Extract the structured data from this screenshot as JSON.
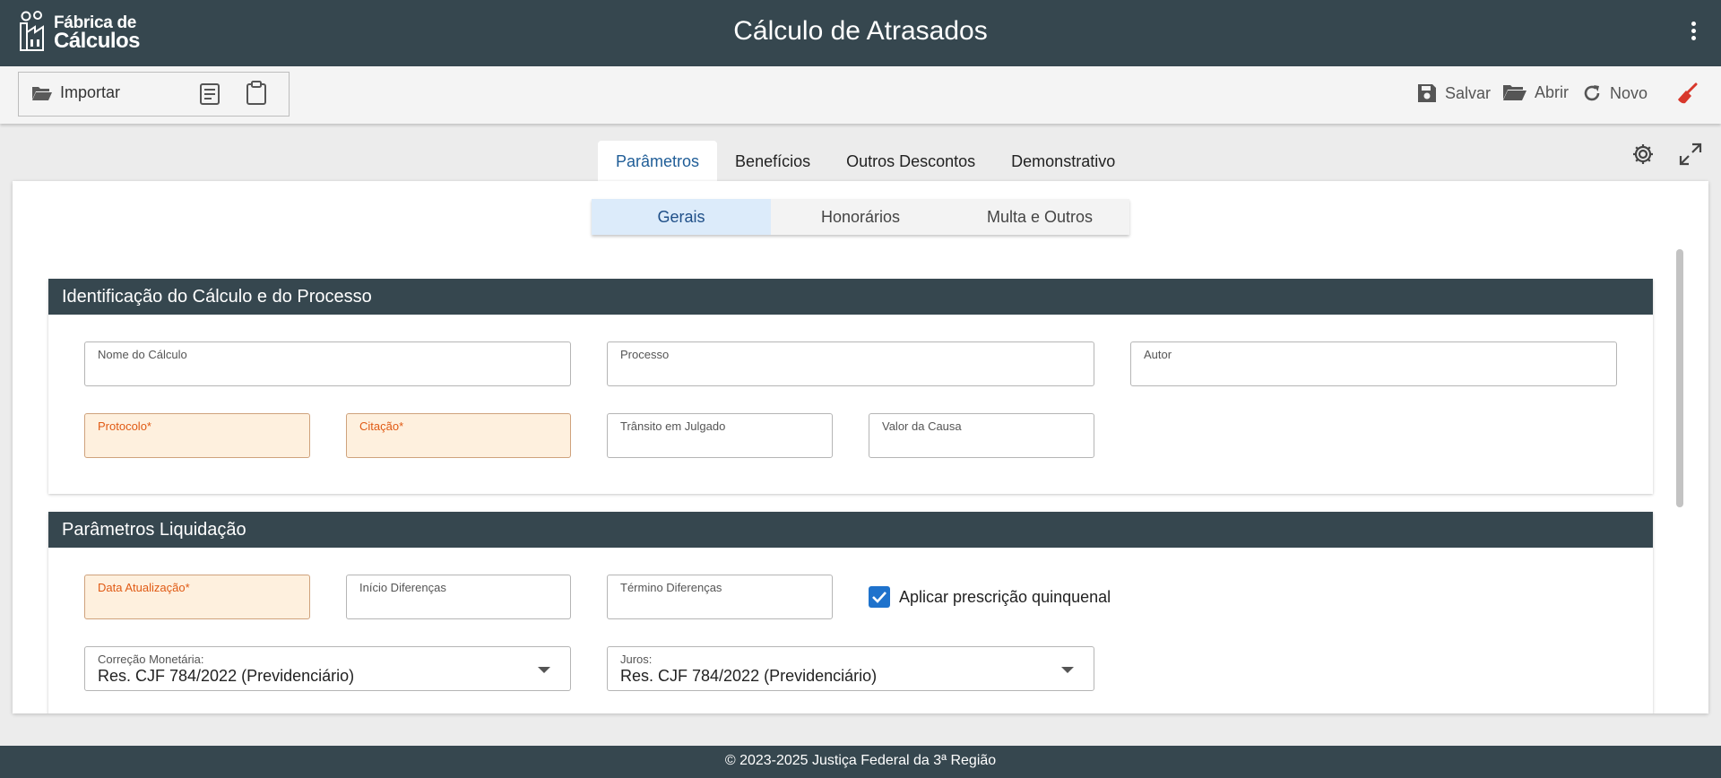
{
  "header": {
    "logo_line1": "Fábrica de",
    "logo_line2": "Cálculos",
    "title": "Cálculo de Atrasados"
  },
  "toolbar": {
    "import_label": "Importar",
    "save_label": "Salvar",
    "open_label": "Abrir",
    "new_label": "Novo"
  },
  "tabs": [
    {
      "label": "Parâmetros",
      "active": true
    },
    {
      "label": "Benefícios"
    },
    {
      "label": "Outros Descontos"
    },
    {
      "label": "Demonstrativo"
    }
  ],
  "subtabs": [
    {
      "label": "Gerais",
      "active": true
    },
    {
      "label": "Honorários"
    },
    {
      "label": "Multa e Outros"
    }
  ],
  "section1": {
    "title": "Identificação do Cálculo e do Processo",
    "fields": {
      "nome_calculo": "Nome do Cálculo",
      "processo": "Processo",
      "autor": "Autor",
      "protocolo": "Protocolo*",
      "citacao": "Citação*",
      "transito": "Trânsito em Julgado",
      "valor_causa": "Valor da Causa"
    }
  },
  "section2": {
    "title": "Parâmetros Liquidação",
    "fields": {
      "data_atualizacao": "Data Atualização*",
      "inicio_diferencas": "Início Diferenças",
      "termino_diferencas": "Término Diferenças",
      "prescricao_label": "Aplicar prescrição quinquenal",
      "prescricao_checked": true,
      "correcao_label": "Correção Monetária:",
      "correcao_value": "Res. CJF 784/2022 (Previdenciário)",
      "juros_label": "Juros:",
      "juros_value": "Res. CJF 784/2022 (Previdenciário)"
    }
  },
  "footer": {
    "text": "© 2023-2025 Justiça Federal da 3ª Região"
  },
  "colors": {
    "header_bg": "#36474f",
    "accent_blue": "#1f5d97",
    "required_bg": "#fef0de",
    "required_text": "#e05a14",
    "clear_icon": "#d8372b"
  }
}
